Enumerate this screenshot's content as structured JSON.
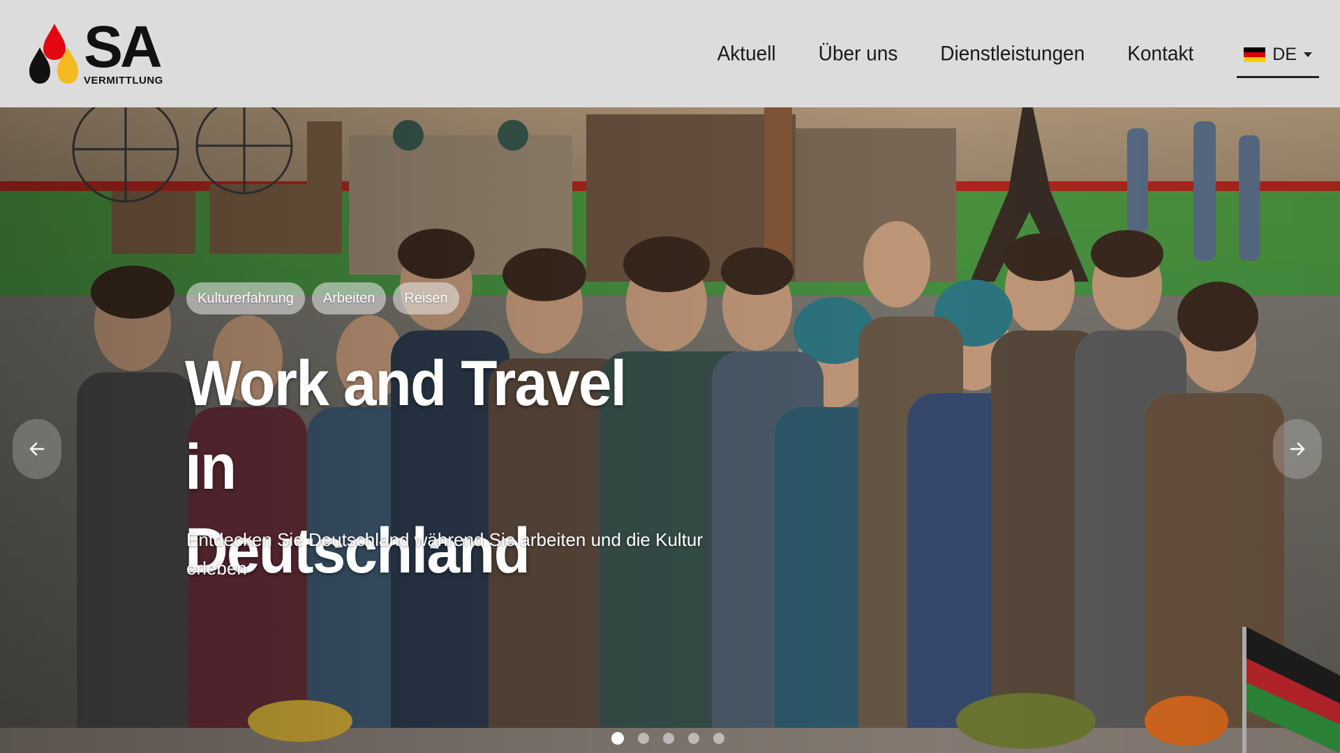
{
  "brand": {
    "name": "SA",
    "subtitle": "VERMITTLUNG",
    "colors": {
      "red": "#e30613",
      "black": "#111111",
      "gold": "#f5b921"
    }
  },
  "nav": {
    "items": [
      "Aktuell",
      "Über uns",
      "Dienstleistungen",
      "Kontakt"
    ],
    "language": {
      "label": "DE",
      "flag_colors": [
        "#000000",
        "#dd0000",
        "#ffce00"
      ]
    }
  },
  "hero": {
    "tags": [
      "Kulturerfahrung",
      "Arbeiten",
      "Reisen"
    ],
    "title_line1": "Work and Travel in",
    "title_line2": "Deutschland",
    "subtitle": "Entdecken Sie Deutschland während Sie arbeiten und die Kultur erleben",
    "prev_icon": "arrow-left-icon",
    "next_icon": "arrow-right-icon",
    "slides": {
      "count": 5,
      "active": 1
    }
  }
}
